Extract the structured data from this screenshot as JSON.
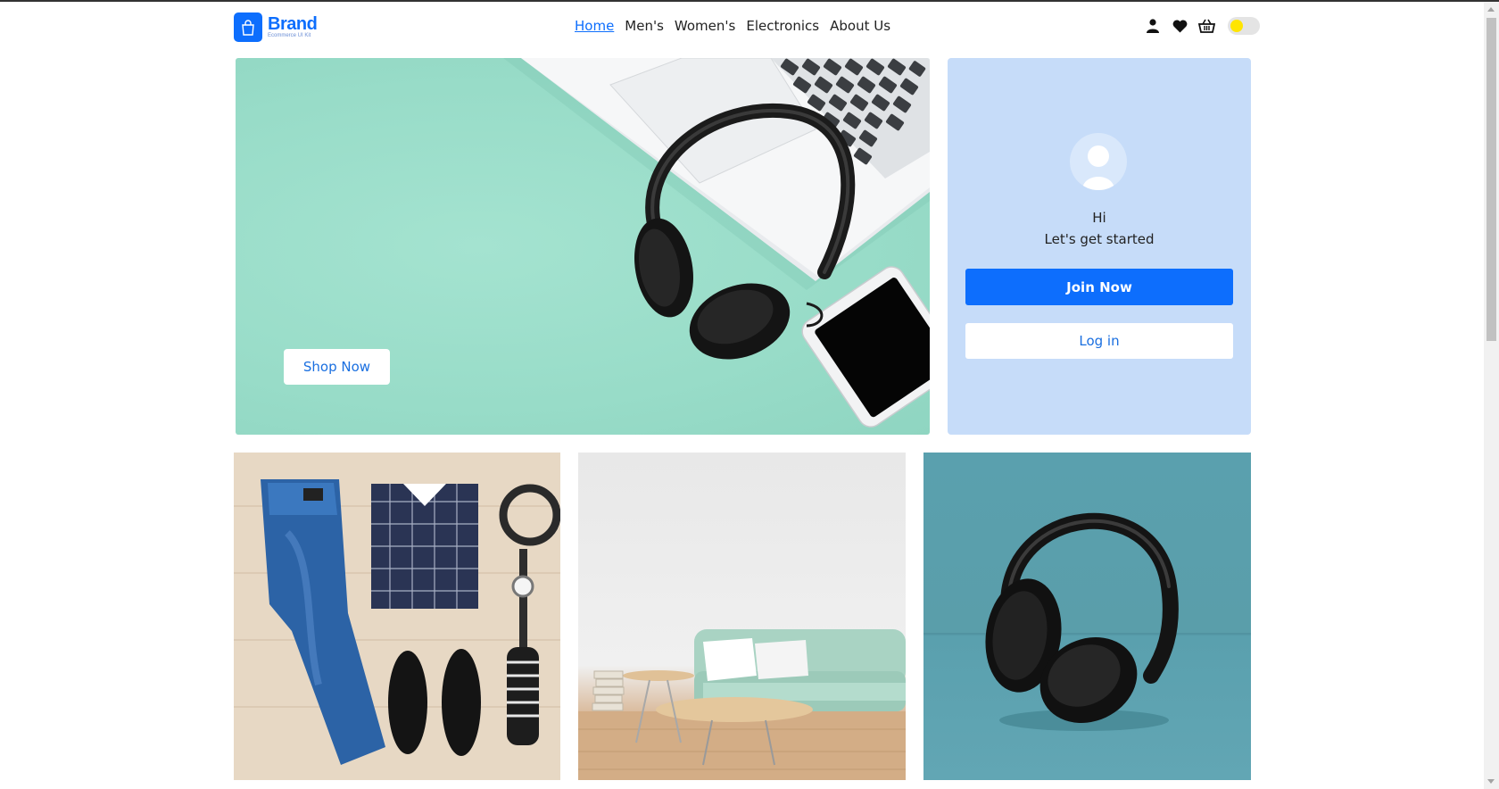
{
  "brand": {
    "name": "Brand",
    "tagline": "Ecommerce UI Kit"
  },
  "nav": {
    "items": [
      "Home",
      "Men's",
      "Women's",
      "Electronics",
      "About Us"
    ],
    "active": "Home"
  },
  "header_icons": [
    "user-icon",
    "heart-icon",
    "basket-icon"
  ],
  "theme_toggle": {
    "knob_color": "#ffe500"
  },
  "hero": {
    "cta_label": "Shop Now",
    "background": "#98dcc8"
  },
  "welcome": {
    "greeting": "Hi",
    "subtitle": "Let's get started",
    "join_label": "Join Now",
    "login_label": "Log in"
  },
  "colors": {
    "accent": "#0d6efd",
    "panel": "#c6dcf9"
  },
  "tiles": [
    {
      "subject": "mens-clothing-flatlay"
    },
    {
      "subject": "living-room-sofa"
    },
    {
      "subject": "black-headphones"
    }
  ]
}
